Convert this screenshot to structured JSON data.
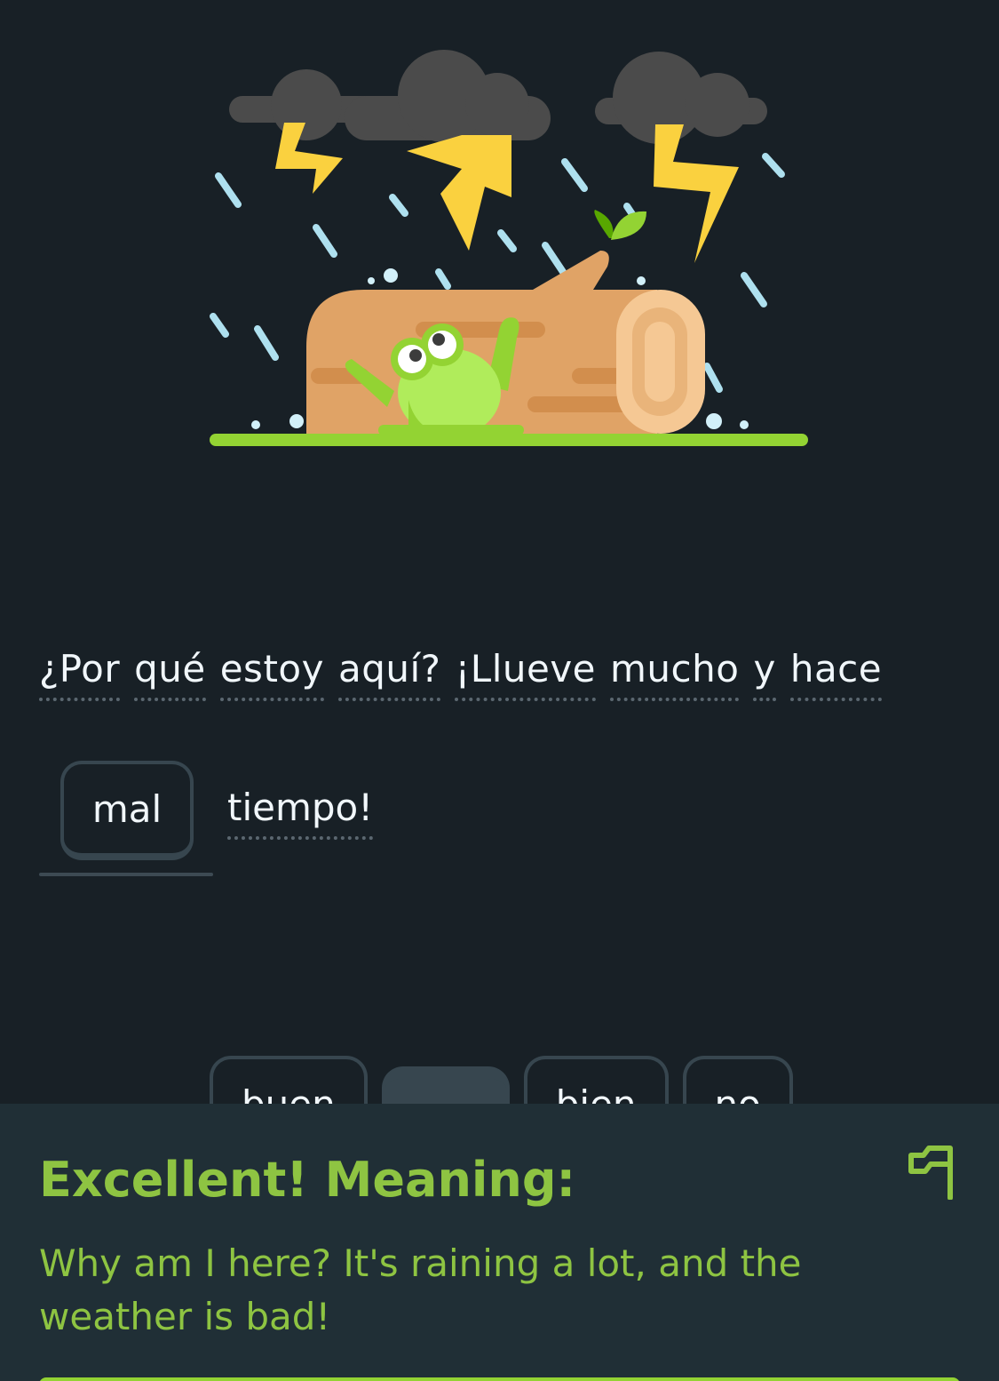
{
  "sentence": {
    "line1": [
      {
        "text": "¿Por",
        "hint": true
      },
      {
        "text": "qué",
        "hint": true
      },
      {
        "text": "estoy",
        "hint": true
      },
      {
        "text": "aquí?",
        "hint": true
      },
      {
        "text": "¡Llueve",
        "hint": true
      },
      {
        "text": "mucho",
        "hint": true
      },
      {
        "text": "y",
        "hint": true
      },
      {
        "text": "hace",
        "hint": true
      }
    ],
    "filled_word": "mal",
    "trailing_word": "tiempo!"
  },
  "word_bank": {
    "options": [
      "buen",
      "",
      "bien",
      "no"
    ]
  },
  "feedback": {
    "title": "Excellent! Meaning:",
    "translation": "Why am I here? It's raining a lot, and the weather is bad!",
    "flag_icon": "report-flag-icon"
  },
  "colors": {
    "background": "#182026",
    "success_green": "#8ec442",
    "panel": "#202f36",
    "chip_border": "#37464f"
  }
}
